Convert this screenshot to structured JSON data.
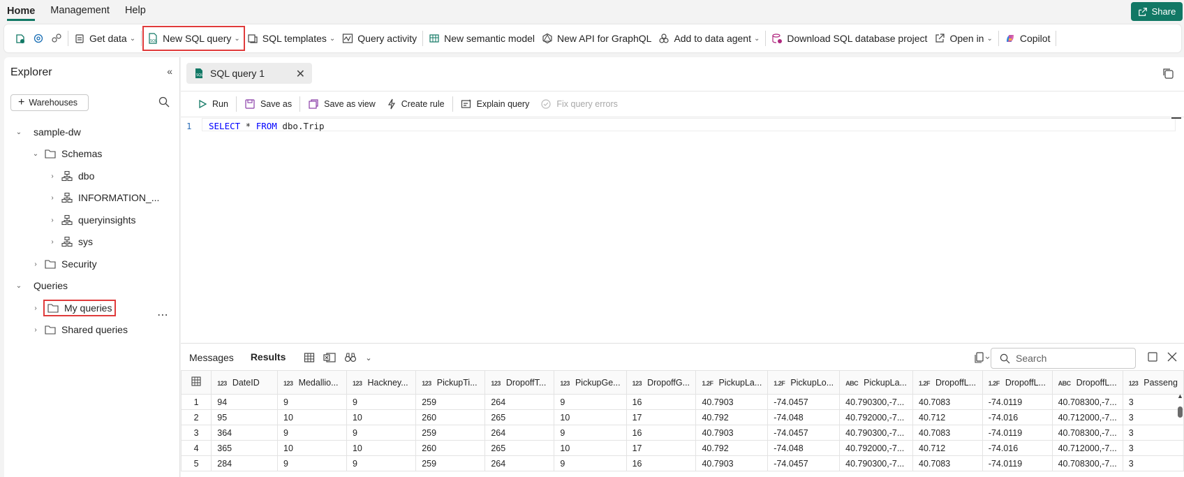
{
  "nav": {
    "tabs": [
      {
        "label": "Home",
        "active": true
      },
      {
        "label": "Management",
        "active": false
      },
      {
        "label": "Help",
        "active": false
      }
    ],
    "share_label": "Share"
  },
  "toolbar": {
    "get_data": "Get data",
    "new_sql_query": "New SQL query",
    "sql_templates": "SQL templates",
    "query_activity": "Query activity",
    "new_semantic_model": "New semantic model",
    "new_api_graphql": "New API for GraphQL",
    "add_to_data_agent": "Add to data agent",
    "download_project": "Download SQL database project",
    "open_in": "Open in",
    "copilot": "Copilot"
  },
  "explorer": {
    "title": "Explorer",
    "warehouses_button": "Warehouses",
    "tree": {
      "database": "sample-dw",
      "schemas_label": "Schemas",
      "schemas": [
        "dbo",
        "INFORMATION_...",
        "queryinsights",
        "sys"
      ],
      "security_label": "Security",
      "queries_label": "Queries",
      "my_queries": "My queries",
      "shared_queries": "Shared queries"
    }
  },
  "editor": {
    "tab_title": "SQL query 1",
    "actions": {
      "run": "Run",
      "save_as": "Save as",
      "save_as_view": "Save as view",
      "create_rule": "Create rule",
      "explain_query": "Explain query",
      "fix_query_errors": "Fix query errors"
    },
    "line_number": "1",
    "code": {
      "kw_select": "SELECT",
      "star": " * ",
      "kw_from": "FROM",
      "table": " dbo.Trip"
    }
  },
  "results": {
    "tabs": {
      "messages": "Messages",
      "results": "Results"
    },
    "search_placeholder": "Search",
    "columns": [
      {
        "type": "123",
        "name": "DateID"
      },
      {
        "type": "123",
        "name": "Medallio..."
      },
      {
        "type": "123",
        "name": "Hackney..."
      },
      {
        "type": "123",
        "name": "PickupTi..."
      },
      {
        "type": "123",
        "name": "DropoffT..."
      },
      {
        "type": "123",
        "name": "PickupGe..."
      },
      {
        "type": "123",
        "name": "DropoffG..."
      },
      {
        "type": "1.2F",
        "name": "PickupLa..."
      },
      {
        "type": "1.2F",
        "name": "PickupLo..."
      },
      {
        "type": "ABC",
        "name": "PickupLa..."
      },
      {
        "type": "1.2F",
        "name": "DropoffL..."
      },
      {
        "type": "1.2F",
        "name": "DropoffL..."
      },
      {
        "type": "ABC",
        "name": "DropoffL..."
      },
      {
        "type": "123",
        "name": "Passeng"
      }
    ],
    "rows": [
      [
        "1",
        "94",
        "9",
        "9",
        "259",
        "264",
        "9",
        "16",
        "40.7903",
        "-74.0457",
        "40.790300,-7...",
        "40.7083",
        "-74.0119",
        "40.708300,-7...",
        "3"
      ],
      [
        "2",
        "95",
        "10",
        "10",
        "260",
        "265",
        "10",
        "17",
        "40.792",
        "-74.048",
        "40.792000,-7...",
        "40.712",
        "-74.016",
        "40.712000,-7...",
        "3"
      ],
      [
        "3",
        "364",
        "9",
        "9",
        "259",
        "264",
        "9",
        "16",
        "40.7903",
        "-74.0457",
        "40.790300,-7...",
        "40.7083",
        "-74.0119",
        "40.708300,-7...",
        "3"
      ],
      [
        "4",
        "365",
        "10",
        "10",
        "260",
        "265",
        "10",
        "17",
        "40.792",
        "-74.048",
        "40.792000,-7...",
        "40.712",
        "-74.016",
        "40.712000,-7...",
        "3"
      ],
      [
        "5",
        "284",
        "9",
        "9",
        "259",
        "264",
        "9",
        "16",
        "40.7903",
        "-74.0457",
        "40.790300,-7...",
        "40.7083",
        "-74.0119",
        "40.708300,-7...",
        "3"
      ]
    ]
  },
  "colors": {
    "accent": "#117865",
    "highlight_box": "#e03b3b",
    "sql_keyword": "#0000ff"
  }
}
